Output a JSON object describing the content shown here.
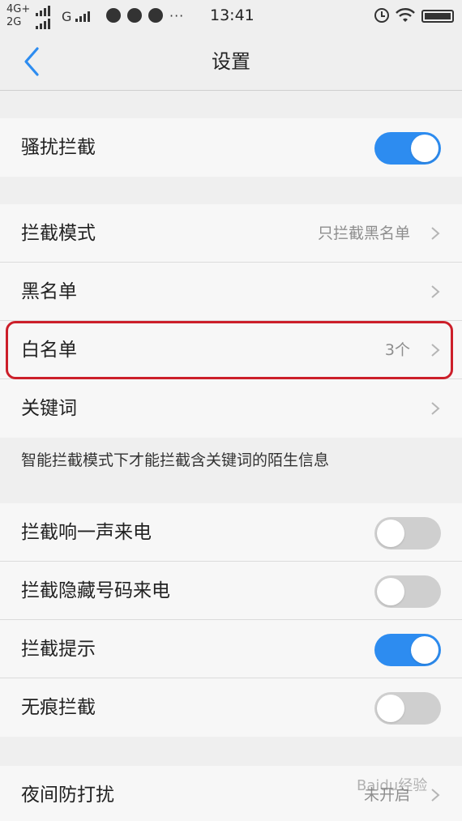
{
  "status_bar": {
    "net1": "4G+",
    "net2": "2G",
    "carrier2": "G",
    "more": "···",
    "time": "13:41"
  },
  "nav": {
    "title": "设置",
    "back_icon": "chevron-left-icon"
  },
  "groups": {
    "g1": [
      {
        "label": "骚扰拦截",
        "toggle": true
      }
    ],
    "g2": [
      {
        "label": "拦截模式",
        "value": "只拦截黑名单"
      },
      {
        "label": "黑名单",
        "value": ""
      },
      {
        "label": "白名单",
        "value": "3个"
      },
      {
        "label": "关键词",
        "value": ""
      }
    ],
    "note": "智能拦截模式下才能拦截含关键词的陌生信息",
    "g3": [
      {
        "label": "拦截响一声来电",
        "toggle": false
      },
      {
        "label": "拦截隐藏号码来电",
        "toggle": false
      },
      {
        "label": "拦截提示",
        "toggle": true
      },
      {
        "label": "无痕拦截",
        "toggle": false
      }
    ],
    "g4": [
      {
        "label": "夜间防打扰",
        "value": "未开启"
      }
    ]
  },
  "watermark": "Baidu经验",
  "colors": {
    "accent": "#2d8cf0",
    "toggle_off": "#cfcfcf",
    "highlight": "#cc1f2a",
    "background": "#efefef"
  }
}
